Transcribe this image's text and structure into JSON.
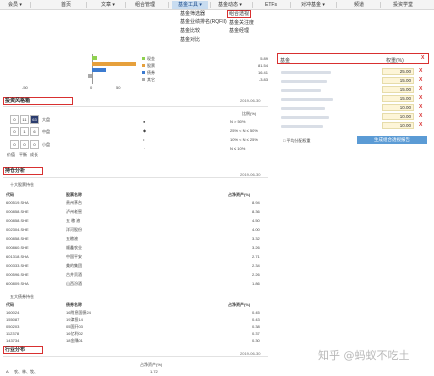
{
  "nav": {
    "items": [
      "会员",
      "首页",
      "文章",
      "组合管理",
      "基金工具",
      "基金动态",
      "ETFs",
      "对冲基金",
      "频道",
      "投资学堂"
    ],
    "active_index": 4
  },
  "dropdown": {
    "col1": [
      "基金筛选器",
      "基金业绩排名(RQFII)",
      "基金比较",
      "基金对比"
    ],
    "col2": [
      "组合透视",
      "基金关注度",
      "基金经理"
    ]
  },
  "axis": {
    "left": "-50",
    "mid": "0",
    "right": "50"
  },
  "legend": [
    {
      "name": "现金",
      "value": "5.89",
      "color": "#8fd14f"
    },
    {
      "name": "股票",
      "value": "81.54",
      "color": "#e6a03c"
    },
    {
      "name": "债券",
      "value": "16.41",
      "color": "#3c7bd0"
    },
    {
      "name": "其它",
      "value": "-3.83",
      "color": "#aaaaaa"
    }
  ],
  "right_panel": {
    "col_fund": "基金",
    "col_weight": "权重(%)",
    "x": "X",
    "weights": [
      "25.00",
      "15.00",
      "15.00",
      "15.00",
      "10.00",
      "10.00",
      "10.00"
    ],
    "checkbox_label": "□ 平均分配权重",
    "button": "生成组合透视报告"
  },
  "style_box": {
    "header": "投资风格箱",
    "date": "2019-06-30",
    "grid": [
      [
        "0",
        "11",
        "63"
      ],
      [
        "0",
        "1",
        "6"
      ],
      [
        "0",
        "0",
        "0"
      ]
    ],
    "size_labels": [
      "大盘",
      "中盘",
      "小盘"
    ],
    "style_labels": [
      "价值",
      "平衡",
      "成长"
    ],
    "legend_title": "比例(%)",
    "legend_items": [
      "N > 50%",
      "25% < N ≤ 50%",
      "10% < N ≤ 25%",
      "N ≤ 10%"
    ]
  },
  "holdings": {
    "header": "持仓分析",
    "date": "2019-06-30",
    "top10_title": "十大股票持仓",
    "col_code": "代码",
    "col_name": "股票名称",
    "col_pct": "占净资产(%)",
    "stocks": [
      {
        "code": "600519.SHA",
        "name": "贵州茅台",
        "pct": "8.94"
      },
      {
        "code": "000858.SHE",
        "name": "泸州老窖",
        "pct": "8.36"
      },
      {
        "code": "000858.SHE",
        "name": "五 粮 液",
        "pct": "4.50"
      },
      {
        "code": "002304.SHE",
        "name": "洋河股份",
        "pct": "4.00"
      },
      {
        "code": "000858.SHE",
        "name": "五粮液",
        "pct": "3.32"
      },
      {
        "code": "000860.SHE",
        "name": "顺鑫农业",
        "pct": "3.26"
      },
      {
        "code": "601318.SHA",
        "name": "中国平安",
        "pct": "2.71"
      },
      {
        "code": "000333.SHE",
        "name": "美的集团",
        "pct": "2.34"
      },
      {
        "code": "000596.SHE",
        "name": "古井贡酒",
        "pct": "2.26"
      },
      {
        "code": "600809.SHA",
        "name": "山西汾酒",
        "pct": "1.86"
      }
    ],
    "top5_bond_title": "五大债券持仓",
    "col_bond_name": "债券名称",
    "bonds": [
      {
        "code": "160024",
        "name": "16附息国债24",
        "pct": "0.45"
      },
      {
        "code": "155087",
        "name": "19津投14",
        "pct": "0.43"
      },
      {
        "code": "050203",
        "name": "05国开03",
        "pct": "0.38"
      },
      {
        "code": "112378",
        "name": "16亿利02",
        "pct": "0.37"
      },
      {
        "code": "143734",
        "name": "18金隅01",
        "pct": "0.30"
      }
    ]
  },
  "industry": {
    "header": "行业分布",
    "date": "2019-06-30",
    "col_pct": "占净资产(%)",
    "row1_idx": "A",
    "row1_name": "农、林、牧、",
    "row1_pct": "1.72"
  },
  "watermark": "知乎 @蚂蚁不吃土"
}
